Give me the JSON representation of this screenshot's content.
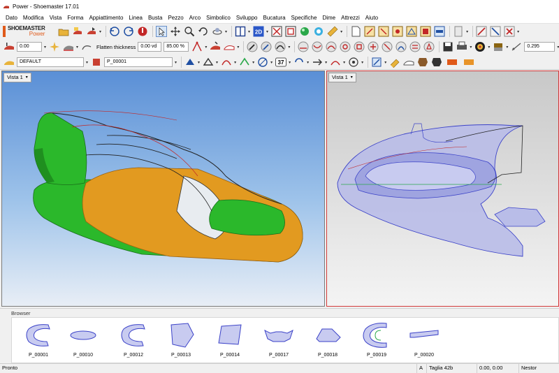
{
  "window": {
    "title": "Power - Shoemaster 17.01"
  },
  "menu": [
    "Dato",
    "Modifica",
    "Vista",
    "Forma",
    "Appiattimento",
    "Linea",
    "Busta",
    "Pezzo",
    "Arco",
    "Simbolico",
    "Sviluppo",
    "Bucatura",
    "Specifiche",
    "Dime",
    "Attrezzi",
    "Aiuto"
  ],
  "logo": {
    "line1": "SHOEMASTER",
    "line2": "Power"
  },
  "toolbar": {
    "value_field": "0.00",
    "flatten_label": "Flatten thickness",
    "flatten_value": "0.00 vd",
    "percent_value": "85.00 %",
    "tolerance_value": "0.295",
    "layer_select": "DEFAULT",
    "piece_select": "P_00001",
    "view2d_label": "2D",
    "num_badge": "37"
  },
  "viewports": {
    "left": {
      "tab_label": "Vista 1"
    },
    "right": {
      "tab_label": "Vista 1"
    }
  },
  "browser": {
    "title": "Browser",
    "pieces": [
      {
        "name": "P_00001",
        "shape": "c-shape"
      },
      {
        "name": "P_00010",
        "shape": "ellipse"
      },
      {
        "name": "P_00012",
        "shape": "c-shape"
      },
      {
        "name": "P_00013",
        "shape": "pentagon"
      },
      {
        "name": "P_00014",
        "shape": "quad"
      },
      {
        "name": "P_00017",
        "shape": "tongue"
      },
      {
        "name": "P_00018",
        "shape": "blob"
      },
      {
        "name": "P_00019",
        "shape": "c-outline"
      },
      {
        "name": "P_00020",
        "shape": "strip"
      }
    ]
  },
  "status": {
    "text": "Pronto",
    "mode": "A",
    "size": "Taglia 42b",
    "coords": "0.00, 0.00",
    "snap": "Nestor"
  },
  "colors": {
    "upper_green": "#2bb82b",
    "sole_orange": "#e29a20",
    "flat_blue": "#b9bde8",
    "viewport_active_border": "#d23a3a"
  }
}
